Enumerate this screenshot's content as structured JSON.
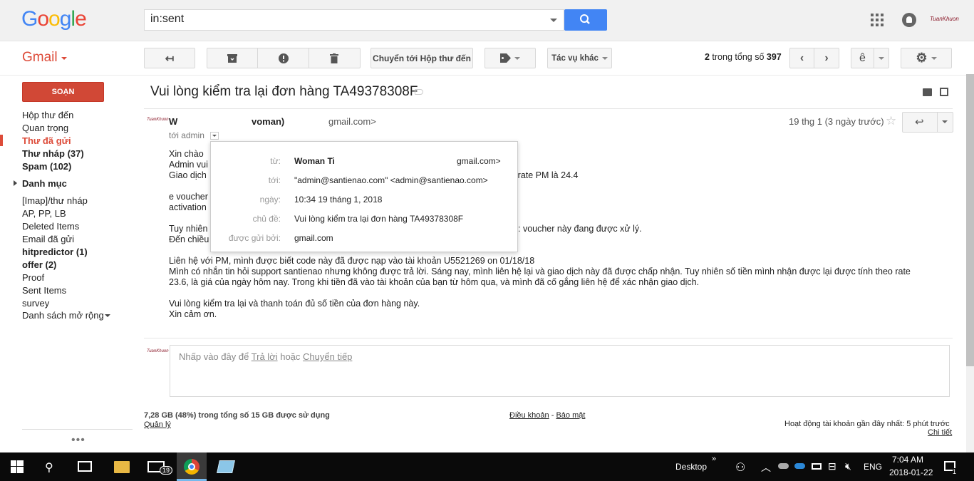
{
  "header": {
    "logo": "Google",
    "search_value": "in:sent",
    "account_logo_text": "TuanKhuon"
  },
  "toolbar": {
    "app_label": "Gmail",
    "move_to_inbox": "Chuyển tới Hộp thư đến",
    "more_actions": "Tác vụ khác",
    "pagination_current": "2",
    "pagination_text": " trong tổng số ",
    "pagination_total": "397",
    "input_tool": "ê"
  },
  "sidebar": {
    "compose": "SOẠN",
    "items": [
      {
        "label": "Hộp thư đến"
      },
      {
        "label": "Quan trọng"
      },
      {
        "label": "Thư đã gửi"
      },
      {
        "label": "Thư nháp (37)"
      },
      {
        "label": "Spam (102)"
      },
      {
        "label": "Danh mục"
      },
      {
        "label": "[Imap]/thư nháp"
      },
      {
        "label": "AP, PP, LB"
      },
      {
        "label": "Deleted Items"
      },
      {
        "label": "Email đã gửi"
      },
      {
        "label": "hitpredictor (1)"
      },
      {
        "label": "offer (2)"
      },
      {
        "label": "Proof"
      },
      {
        "label": "Sent Items"
      },
      {
        "label": "survey"
      },
      {
        "label": "Danh sách mở rộng"
      }
    ],
    "dots": "•••"
  },
  "message": {
    "subject": "Vui lòng kiểm tra lại đơn hàng TA49378308F",
    "sender_name_start": "W",
    "sender_name_end": "voman)",
    "sender_email_fragment": "gmail.com>",
    "to_line": "tới admin",
    "date": "19 thg 1 (3 ngày trước)",
    "body": [
      "Xin chào",
      "Admin vui",
      "Giao dịch",
      "",
      "e voucher",
      "activation",
      "",
      "Tuy nhiên",
      "Đến chiều",
      "",
      "Liên hệ với PM, mình được biết  code này đã được nạp vào tài khoản U5521269 on 01/18/18",
      "Mình có nhắn tin hỏi support santienao nhưng không được trả lời. Sáng nay, mình liên hệ lại và giao dịch này đã được chấp nhận. Tuy nhiên số tiền mình nhận được lại được tính theo rate",
      "23.6, là giá của ngày hôm nay. Trong khi tiền đã vào tài khoản của bạn từ hôm qua, và mình đã cố gắng liên hệ để xác nhận giao dịch.",
      "",
      "Vui lòng kiểm tra lại và thanh toán đủ số tiền của đơn hàng này.",
      "Xin cảm ơn."
    ],
    "body_fragment_rate": "có rate PM là 24.4",
    "body_fragment_voucher": ": voucher này đang được xử lý."
  },
  "details_popup": {
    "from_label": "từ:",
    "from_name": "Woman Ti",
    "from_email": "gmail.com>",
    "to_label": "tới:",
    "to_value": "\"admin@santienao.com\" <admin@santienao.com>",
    "date_label": "ngày:",
    "date_value": "10:34 19 tháng 1, 2018",
    "subject_label": "chủ đề:",
    "subject_value": "Vui lòng kiểm tra lại đơn hàng TA49378308F",
    "sent_by_label": "được gửi bởi:",
    "sent_by_value": "gmail.com"
  },
  "reply": {
    "prefix": "Nhấp vào đây để ",
    "reply_link": "Trả lời",
    "or": " hoặc ",
    "forward_link": "Chuyển tiếp"
  },
  "footer": {
    "storage": "7,28 GB (48%) trong tổng số 15 GB được sử dụng",
    "manage": "Quản lý",
    "terms": "Điều khoản",
    "terms_sep": " - ",
    "privacy": "Bảo mật",
    "activity": "Hoạt động tài khoản gần đây nhất: 5 phút trước",
    "details": "Chi tiết"
  },
  "taskbar": {
    "desktop": "Desktop",
    "lang": "ENG",
    "time": "7:04 AM",
    "date": "2018-01-22",
    "mail_badge": "19",
    "notif_count": "1"
  },
  "colors": {
    "accent_red": "#dd4b39",
    "compose_red": "#d14836",
    "search_blue": "#4285f4"
  }
}
